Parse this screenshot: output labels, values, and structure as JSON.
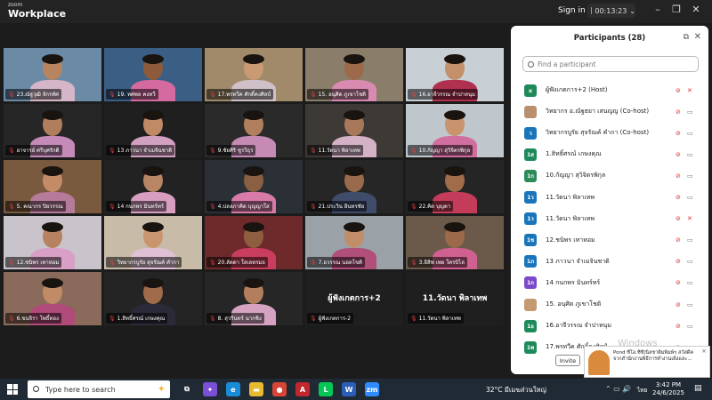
{
  "app": {
    "brand_small": "zoom",
    "brand_name": "Workplace",
    "sign_in": "Sign in",
    "timer": "00:13:23",
    "window_controls": [
      "minimize-icon",
      "restore-icon",
      "close-icon"
    ]
  },
  "tiles": [
    {
      "name": "23.ณัฐวุฒิ จักรทัศ",
      "bg": "#6a8aa6",
      "skin": "#b7845f",
      "shirt": "#d4b6c8"
    },
    {
      "name": "19. ทศพล คงทวี",
      "bg": "#3b5e85",
      "skin": "#8d5a3b",
      "shirt": "#d46aa0"
    },
    {
      "name": "17.พรทวีค ศักดิ์คงศิลป์",
      "bg": "#a08a6a",
      "skin": "#c99a74",
      "shirt": "#d0c0c8"
    },
    {
      "name": "15. อนุศิต ภูเขาโชติ",
      "bg": "#8a7d6a",
      "skin": "#9c6a4a",
      "shirt": "#d98ab0"
    },
    {
      "name": "16.อาจีวรรณ จำปาหนุม",
      "bg": "#c8d0d6",
      "skin": "#c48f6b",
      "shirt": "#b03050"
    },
    {
      "name": "อาจารย์ ศรีบุศรักดิ",
      "bg": "#262626",
      "skin": "#b07e5c",
      "shirt": "#c68ab8"
    },
    {
      "name": "13 ภาวนา จำเมจินชาติ",
      "bg": "#1f1f1f",
      "skin": "#c08a66",
      "shirt": "#d2a0c0"
    },
    {
      "name": "9.ชัยศิริ ชูรวีธุร",
      "bg": "#2a2a2a",
      "skin": "#b0805e",
      "shirt": "#c58bb5"
    },
    {
      "name": "11.วัดนา พิลาเทพ",
      "bg": "#3d3a36",
      "skin": "#a8785a",
      "shirt": "#d3b2c6"
    },
    {
      "name": "10.กัญญา สุวิจิตรพิกุล",
      "bg": "#bfc6cc",
      "skin": "#c9936d",
      "shirt": "#d06ea0"
    },
    {
      "name": "5. คณากร ปิยวรรณ",
      "bg": "#7a5a3e",
      "skin": "#c48c66",
      "shirt": "#b67a9a"
    },
    {
      "name": "14 กนกพร มินทร์ทร์",
      "bg": "#222",
      "skin": "#b98665",
      "shirt": "#d79ec0"
    },
    {
      "name": "4.ปลลภาคิด บุญญาใส",
      "bg": "#2b3036",
      "skin": "#8a5f42",
      "shirt": "#d77aa8"
    },
    {
      "name": "21.ประวิน อินทรชัย",
      "bg": "#262626",
      "skin": "#9a6a4c",
      "shirt": "#3f4c6a"
    },
    {
      "name": "22.คิด บุญตา",
      "bg": "#252525",
      "skin": "#a06c4a",
      "shirt": "#c43c5a"
    },
    {
      "name": "12.ชนิพร เทาหอม",
      "bg": "#c9c3cb",
      "skin": "#b68262",
      "shirt": "#d8a0c6"
    },
    {
      "name": "วิทยากรบูรัย สุจรัณค์ คำกา",
      "bg": "#c8bba8",
      "skin": "#c9956f",
      "shirt": "#e0c0d4"
    },
    {
      "name": "20.ลัดดา ใสเลหรมธ",
      "bg": "#6e2a2a",
      "skin": "#8f5e40",
      "shirt": "#c93e5e"
    },
    {
      "name": "7.อวรรณ นอดโขติ",
      "bg": "#9aa2a8",
      "skin": "#c28d69",
      "shirt": "#b0507a"
    },
    {
      "name": "3.อิสิฟ เพย ใครบิไล",
      "bg": "#6b5a4a",
      "skin": "#9a6a4a",
      "shirt": "#d06090"
    },
    {
      "name": "6.ขนจิรา โพธิ์ทอง",
      "bg": "#8a6a5a",
      "skin": "#c08b66",
      "shirt": "#b04a78"
    },
    {
      "name": "1.สิทธิ์ศรณ์ เกษงคุณ",
      "bg": "#242424",
      "skin": "#a06b4a",
      "shirt": "#2a2a38"
    },
    {
      "name": "8. สุวรินทร์ นากชิง",
      "bg": "#262626",
      "skin": "#b27e5c",
      "shirt": "#d5a2c2"
    },
    {
      "name": "ผู้ฟังเกตการ-2",
      "big": "ผู้ฟังเกตการ+2"
    },
    {
      "name": "11.วัดนา พิลาเทพ",
      "big": "11.วัดนา พิลาเทพ"
    }
  ],
  "panel": {
    "title": "Participants (28)",
    "search_placeholder": "Find a participant",
    "invite_label": "Invite",
    "watermark": "Windows",
    "participants": [
      {
        "initials": "ผ",
        "color": "#1e8a5a",
        "name": "ผู้ฟังเกตการ+2 (Host)",
        "video": "video-off",
        "mic": "mic-off"
      },
      {
        "initials": "",
        "color": "#b89070",
        "name": "วิทยากร อ.ณัฐธยา  เสนญญ (Co-host)",
        "video": "video-off",
        "mic": "mic-on"
      },
      {
        "initials": "ว",
        "color": "#1b75bb",
        "name": "วิทยากรบูรัย สุจรัณค์ คำกา (Co-host)",
        "video": "video-off",
        "mic": "mic-on"
      },
      {
        "initials": "1ส",
        "color": "#1e8a5a",
        "name": "1.สิทธิ์ศรณ์ เกษงคุณ",
        "video": "video-off",
        "mic": "mic-on"
      },
      {
        "initials": "1ก",
        "color": "#2b8a5a",
        "name": "10.กัญญา สุวิจิตรพิกุล",
        "video": "video-off",
        "mic": "mic-on"
      },
      {
        "initials": "1ว",
        "color": "#1b75bb",
        "name": "11.วัดนา พิลาเทพ",
        "video": "video-off",
        "mic": "mic-on"
      },
      {
        "initials": "1ว",
        "color": "#1b75bb",
        "name": "11.วัดนา พิลาเทพ",
        "video": "video-off",
        "mic": "mic-off"
      },
      {
        "initials": "1ช",
        "color": "#1b75bb",
        "name": "12.ชนิพร เทาหอม",
        "video": "video-off",
        "mic": "mic-on"
      },
      {
        "initials": "1ภ",
        "color": "#1b75bb",
        "name": "13 ภาวนา จำเมจินชาติ",
        "video": "video-off",
        "mic": "mic-on"
      },
      {
        "initials": "1ก",
        "color": "#7a4ac8",
        "name": "14 กนกพร มินทร์ทร์",
        "video": "video-off",
        "mic": "mic-on"
      },
      {
        "initials": "",
        "color": "#c49a70",
        "name": "15. อนุศิต ภูเขาโชติ",
        "video": "video-off",
        "mic": "mic-on"
      },
      {
        "initials": "1อ",
        "color": "#1e8a5a",
        "name": "16.อาจีวรรณ จำปาหนุม",
        "video": "video-off",
        "mic": "mic-on"
      },
      {
        "initials": "1พ",
        "color": "#1e8a5a",
        "name": "17.พรทวีค ศักดิ์คงศิลป์",
        "video": "video-off",
        "mic": "mic-on"
      }
    ]
  },
  "notification": {
    "text": "Pond ซีโอ.ซีซี|นิลชาติมพิมพ์ๆ สวัสดีค จากสำนักงานพิธีการทำงานเดิงและ...",
    "close": "×"
  },
  "taskbar": {
    "search_placeholder": "Type here to search",
    "apps": [
      {
        "icon": "task-view-icon",
        "label": "⧉",
        "color": "transparent"
      },
      {
        "icon": "copilot-icon",
        "label": "✦",
        "color": "#7b4fd6"
      },
      {
        "icon": "edge-icon",
        "label": "e",
        "color": "#1a8bd6"
      },
      {
        "icon": "file-explorer-icon",
        "label": "▬",
        "color": "#e8b931"
      },
      {
        "icon": "chrome-icon",
        "label": "●",
        "color": "#d84537"
      },
      {
        "icon": "acrobat-icon",
        "label": "A",
        "color": "#c1272d"
      },
      {
        "icon": "line-icon",
        "label": "L",
        "color": "#06c755"
      },
      {
        "icon": "word-icon",
        "label": "W",
        "color": "#2b5eb8"
      },
      {
        "icon": "zoom-icon",
        "label": "zm",
        "color": "#2d8cff"
      }
    ],
    "weather": "32°C มีเมฆส่วนใหญ่",
    "lang": "ไทย",
    "time": "3:42 PM",
    "date": "24/6/2025"
  }
}
